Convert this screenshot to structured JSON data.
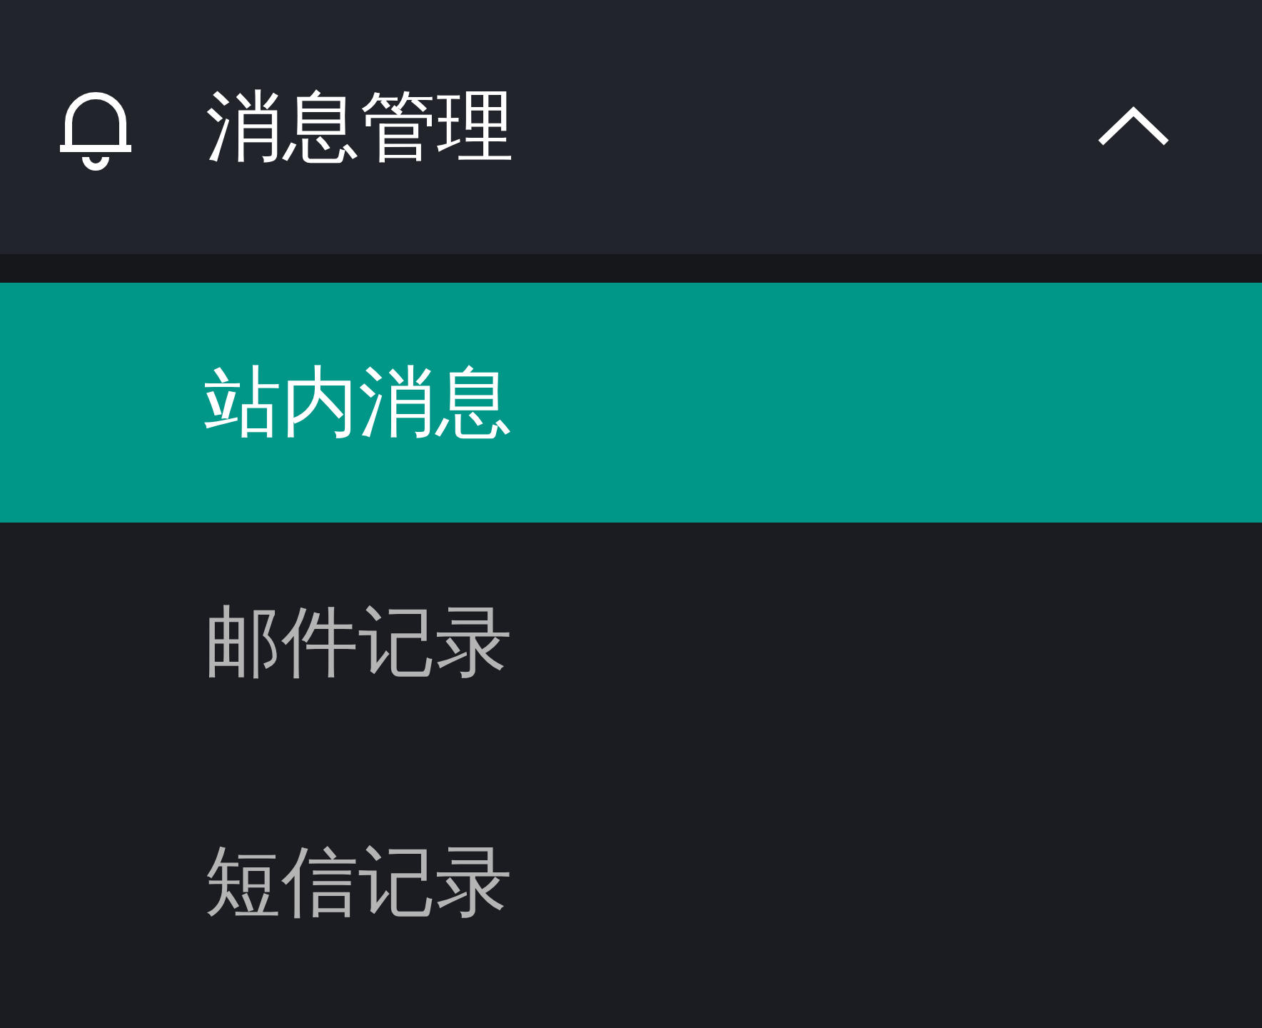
{
  "menu": {
    "title": "消息管理",
    "expanded": true,
    "items": [
      {
        "label": "站内消息",
        "selected": true
      },
      {
        "label": "邮件记录",
        "selected": false
      },
      {
        "label": "短信记录",
        "selected": false
      }
    ]
  }
}
